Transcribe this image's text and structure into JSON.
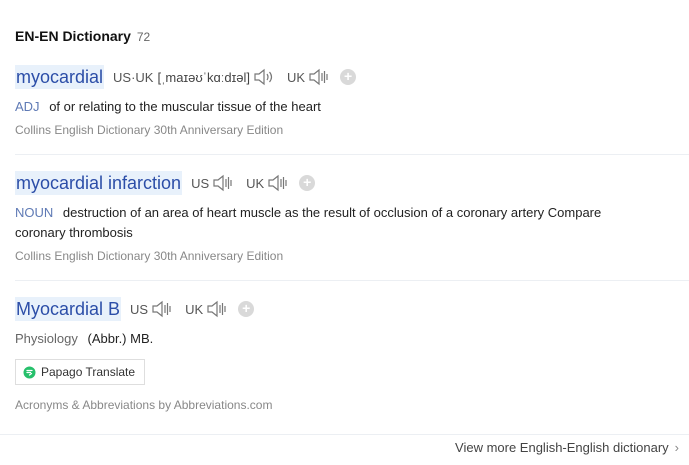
{
  "header": {
    "title": "EN-EN Dictionary",
    "count": "72"
  },
  "entries": [
    {
      "word": "myocardial",
      "us_label": "US·UK",
      "ipa": "[ˌmaɪəʊˈkɑːdɪəl]",
      "uk_label": "UK",
      "pos": "ADJ",
      "definition": "of or relating to the muscular tissue of the heart",
      "source": "Collins English Dictionary 30th Anniversary Edition"
    },
    {
      "word": "myocardial infarction",
      "us_label": "US",
      "uk_label": "UK",
      "pos": "NOUN",
      "definition": "destruction of an area of heart muscle as the result of occlusion of a coronary artery Compare coronary thrombosis",
      "source": "Collins English Dictionary 30th Anniversary Edition"
    },
    {
      "word": "Myocardial B",
      "us_label": "US",
      "uk_label": "UK",
      "pos": "Physiology",
      "definition": "(Abbr.) MB.",
      "translate_label": "Papago Translate",
      "source": "Acronyms & Abbreviations by Abbreviations.com"
    }
  ],
  "footer": {
    "more_label": "View more English-English dictionary"
  },
  "colors": {
    "link": "#2c4ea8",
    "highlight": "#e8f1fb",
    "pos": "#5f7ab5",
    "muted": "#888888"
  },
  "icons": {
    "speaker": "speaker-icon",
    "add": "add-icon",
    "papago": "papago-icon",
    "chevron": "chevron-right-icon"
  }
}
